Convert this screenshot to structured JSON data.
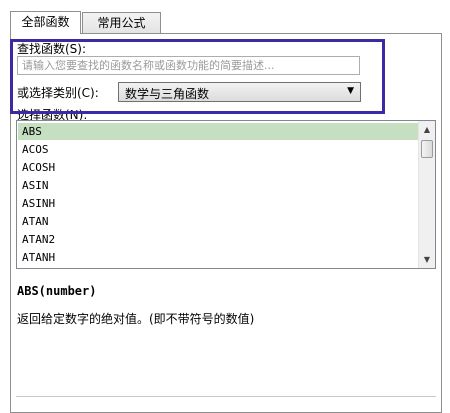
{
  "tabs": [
    {
      "label": "全部函数",
      "active": true
    },
    {
      "label": "常用公式",
      "active": false
    }
  ],
  "search": {
    "label": "查找函数(S):",
    "placeholder": "请输入您要查找的函数名称或函数功能的简要描述..."
  },
  "category": {
    "label": "或选择类别(C):",
    "selected": "数学与三角函数"
  },
  "function_list": {
    "label": "选择函数(N):",
    "items": [
      "ABS",
      "ACOS",
      "ACOSH",
      "ASIN",
      "ASINH",
      "ATAN",
      "ATAN2",
      "ATANH"
    ],
    "selected_index": 0
  },
  "detail": {
    "signature": "ABS(number)",
    "description": "返回给定数字的绝对值。(即不带符号的数值)"
  },
  "colors": {
    "highlight_border": "#3a2aa4",
    "selected_row": "#c6dfc0"
  },
  "icons": {
    "scroll_up": "triangle-up-icon",
    "scroll_down": "triangle-down-icon",
    "dropdown": "triangle-down-icon"
  }
}
